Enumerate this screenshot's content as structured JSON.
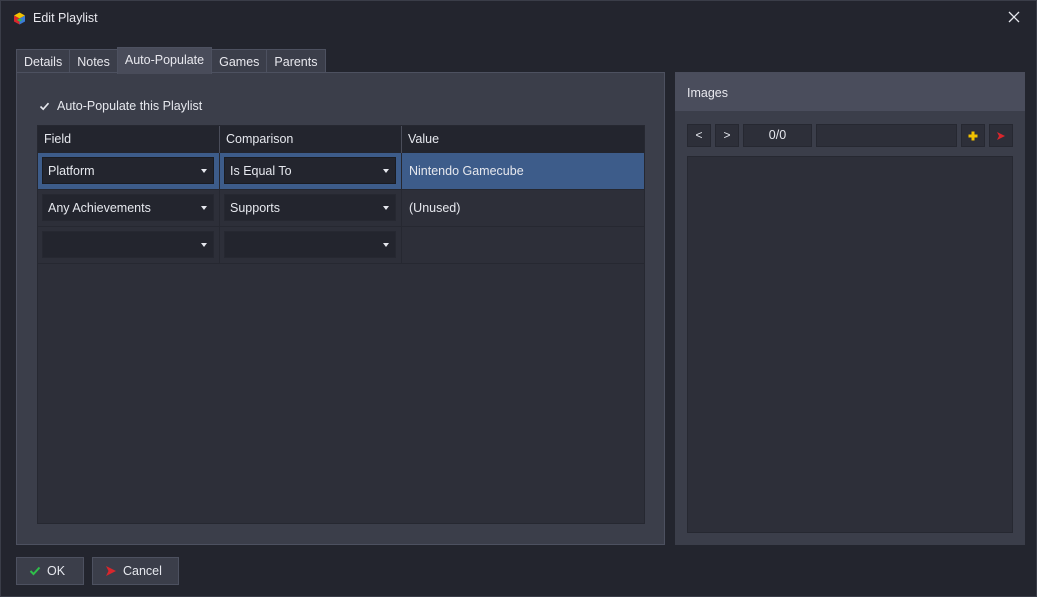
{
  "window": {
    "title": "Edit Playlist",
    "app_icon": "cube-icon",
    "close_icon": "close-icon"
  },
  "tabs": [
    {
      "label": "Details",
      "active": false
    },
    {
      "label": "Notes",
      "active": false
    },
    {
      "label": "Auto-Populate",
      "active": true
    },
    {
      "label": "Games",
      "active": false
    },
    {
      "label": "Parents",
      "active": false
    }
  ],
  "auto_populate": {
    "checkbox_label": "Auto-Populate this Playlist",
    "checked": true,
    "columns": [
      "Field",
      "Comparison",
      "Value"
    ],
    "rows": [
      {
        "field": "Platform",
        "comparison": "Is Equal To",
        "value": "Nintendo Gamecube",
        "selected": true
      },
      {
        "field": "Any Achievements",
        "comparison": "Supports",
        "value": "(Unused)",
        "selected": false
      },
      {
        "field": "",
        "comparison": "",
        "value": "",
        "selected": false
      }
    ]
  },
  "images": {
    "title": "Images",
    "prev_label": "<",
    "next_label": ">",
    "counter": "0/0",
    "add_icon": "plus-icon",
    "remove_icon": "remove-icon"
  },
  "footer": {
    "ok_label": "OK",
    "cancel_label": "Cancel"
  },
  "colors": {
    "accent_selected_row": "#3d5c8a",
    "ok_check": "#2fbf4a",
    "cancel_x": "#d9262c",
    "add_plus": "#f2c200"
  }
}
